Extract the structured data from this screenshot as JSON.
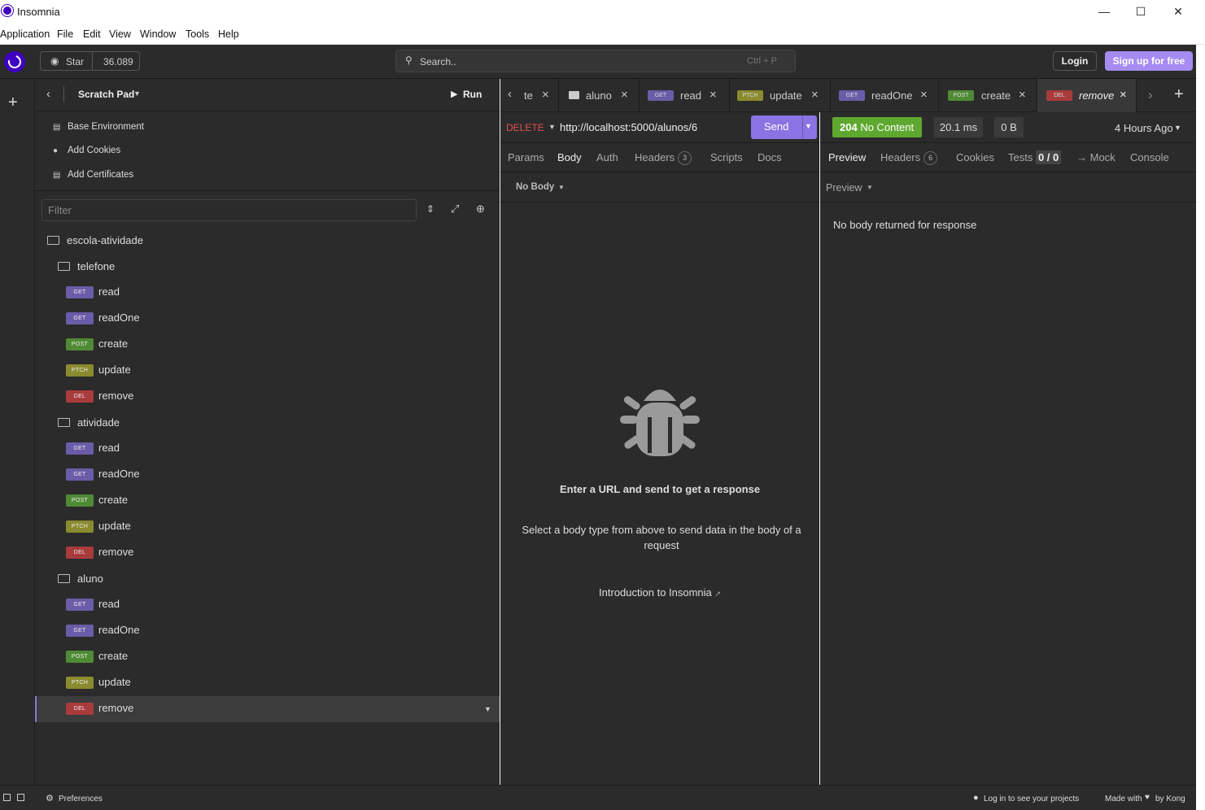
{
  "window": {
    "title": "Insomnia"
  },
  "menubar": [
    "Application",
    "File",
    "Edit",
    "View",
    "Window",
    "Tools",
    "Help"
  ],
  "topbar": {
    "star_label": "Star",
    "star_count": "36.089",
    "search_placeholder": "Search..",
    "search_shortcut": "Ctrl + P",
    "login": "Login",
    "signup": "Sign up for free"
  },
  "sidebar": {
    "title": "Scratch Pad",
    "run": "Run",
    "links": [
      "Base Environment",
      "Add Cookies",
      "Add Certificates"
    ],
    "filter_placeholder": "Filter",
    "collection": "escola-atividade",
    "folders": [
      {
        "name": "telefone",
        "requests": [
          {
            "method": "GET",
            "name": "read"
          },
          {
            "method": "GET",
            "name": "readOne"
          },
          {
            "method": "POST",
            "name": "create"
          },
          {
            "method": "PTCH",
            "name": "update"
          },
          {
            "method": "DEL",
            "name": "remove"
          }
        ]
      },
      {
        "name": "atividade",
        "requests": [
          {
            "method": "GET",
            "name": "read"
          },
          {
            "method": "GET",
            "name": "readOne"
          },
          {
            "method": "POST",
            "name": "create"
          },
          {
            "method": "PTCH",
            "name": "update"
          },
          {
            "method": "DEL",
            "name": "remove"
          }
        ]
      },
      {
        "name": "aluno",
        "requests": [
          {
            "method": "GET",
            "name": "read"
          },
          {
            "method": "GET",
            "name": "readOne"
          },
          {
            "method": "POST",
            "name": "create"
          },
          {
            "method": "PTCH",
            "name": "update"
          },
          {
            "method": "DEL",
            "name": "remove"
          }
        ]
      }
    ]
  },
  "tabs": {
    "partial": "te",
    "items": [
      {
        "method": "",
        "name": "aluno"
      },
      {
        "method": "GET",
        "name": "read"
      },
      {
        "method": "PTCH",
        "name": "update"
      },
      {
        "method": "GET",
        "name": "readOne"
      },
      {
        "method": "POST",
        "name": "create"
      },
      {
        "method": "DEL",
        "name": "remove"
      }
    ]
  },
  "request": {
    "method": "DELETE",
    "url": "http://localhost:5000/alunos/6",
    "send": "Send",
    "tabs": [
      "Params",
      "Body",
      "Auth",
      "Headers",
      "Scripts",
      "Docs"
    ],
    "headers_count": "3",
    "body_type": "No Body",
    "empty_title": "Enter a URL and send to get a response",
    "empty_text": "Select a body type from above to send data in the body of a request",
    "intro_link": "Introduction to Insomnia"
  },
  "response": {
    "status_code": "204",
    "status_text": "No Content",
    "time": "20.1 ms",
    "size": "0 B",
    "when": "4 Hours Ago",
    "tabs": [
      "Preview",
      "Headers",
      "Cookies",
      "Tests",
      "→ Mock",
      "Console"
    ],
    "headers_count": "6",
    "tests_count": "0 / 0",
    "preview_mode": "Preview",
    "body_message": "No body returned for response"
  },
  "statusbar": {
    "preferences": "Preferences",
    "login_msg": "Log in to see your projects",
    "made_with": "Made with",
    "by": "by Kong"
  },
  "colors": {
    "accent": "#4000bf",
    "send": "#8c73e3",
    "status_ok": "#5fa830",
    "delete": "#e0504f"
  }
}
